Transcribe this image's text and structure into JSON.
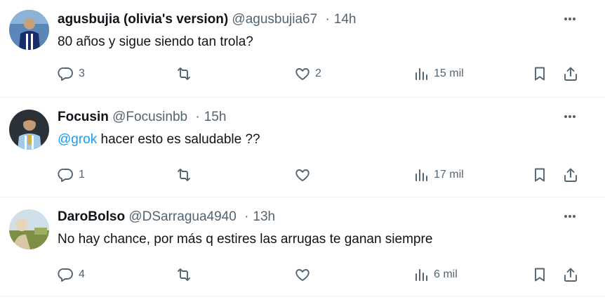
{
  "tweets": [
    {
      "name": "agusbujia (olivia's version)",
      "handle": "@agusbujia67",
      "time": "14h",
      "text": "80 años y sigue siendo tan trola?",
      "mention": "",
      "replies": "3",
      "retweets": "",
      "likes": "2",
      "views": "15 mil"
    },
    {
      "name": "Focusin",
      "handle": "@Focusinbb",
      "time": "15h",
      "mention": "@grok",
      "text": " hacer esto es saludable ??",
      "replies": "1",
      "retweets": "",
      "likes": "",
      "views": "17 mil"
    },
    {
      "name": "DaroBolso",
      "handle": "@DSarragua4940",
      "time": "13h",
      "text": "No hay chance, por más q estires las arrugas te ganan siempre",
      "mention": "",
      "replies": "4",
      "retweets": "",
      "likes": "",
      "views": "6 mil"
    }
  ],
  "separator": "·",
  "icons": {
    "reply": "reply-icon",
    "retweet": "retweet-icon",
    "like": "heart-icon",
    "views": "views-icon",
    "bookmark": "bookmark-icon",
    "share": "share-icon",
    "more": "more-icon"
  },
  "colors": {
    "secondary": "#536471",
    "link": "#1d9bf0",
    "text": "#0f1419",
    "divider": "#eff3f4"
  }
}
